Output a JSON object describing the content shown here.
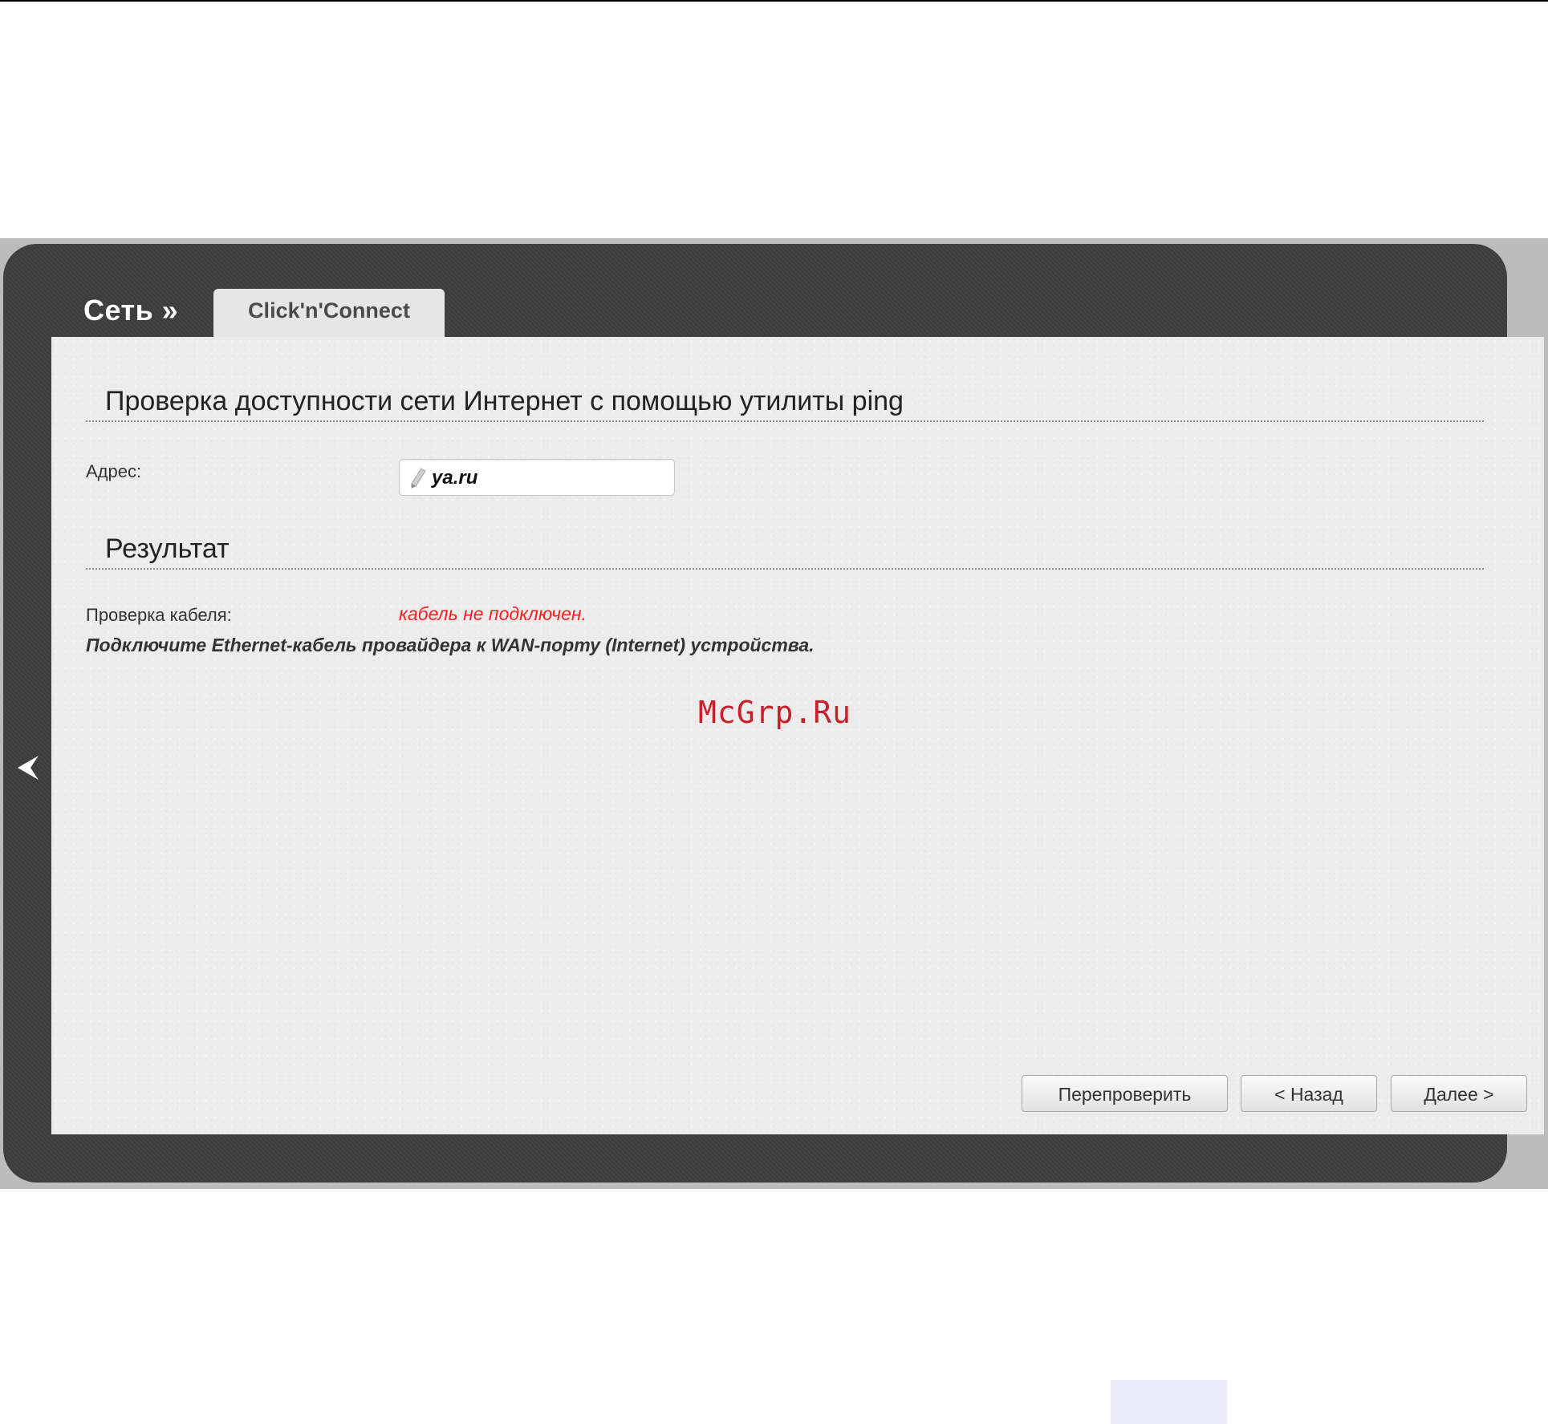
{
  "breadcrumb": {
    "section": "Сеть »"
  },
  "tab": {
    "label": "Click'n'Connect"
  },
  "ping_section": {
    "title": "Проверка доступности сети Интернет с помощью утилиты ping",
    "address_label": "Адрес:",
    "address_value": "ya.ru"
  },
  "result_section": {
    "title": "Результат",
    "cable_check_label": "Проверка кабеля:",
    "cable_check_status": "кабель не подключен.",
    "instruction": "Подключите Ethernet-кабель провайдера к WAN-порту (Internet) устройства."
  },
  "watermark": "McGrp.Ru",
  "buttons": {
    "recheck": "Перепроверить",
    "back": "< Назад",
    "next": "Далее >"
  },
  "colors": {
    "shell": "#3e3e3e",
    "panel": "#ececec",
    "error": "#ff1f1f",
    "watermark": "#c8202a"
  },
  "icons": {
    "collapse": "chevron-left-icon",
    "address": "pencil-icon"
  }
}
